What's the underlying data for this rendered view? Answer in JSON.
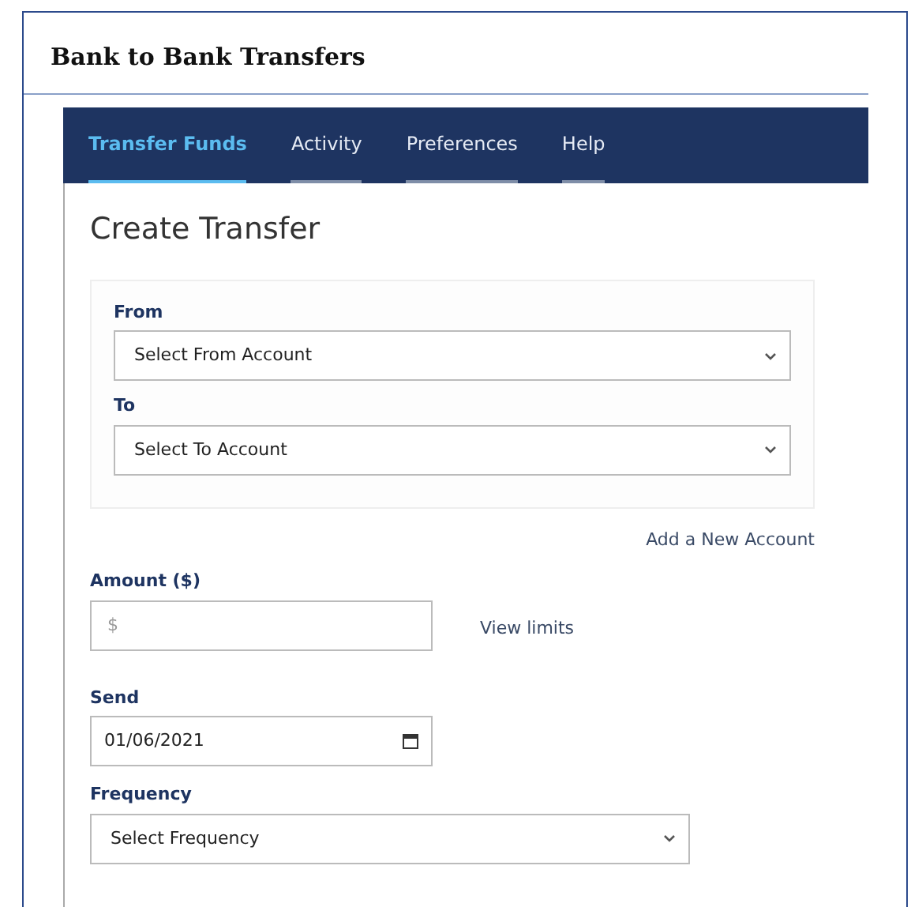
{
  "header": {
    "title": "Bank to Bank Transfers"
  },
  "tabs": [
    {
      "label": "Transfer Funds",
      "selected": true
    },
    {
      "label": "Activity",
      "selected": false
    },
    {
      "label": "Preferences",
      "selected": false
    },
    {
      "label": "Help",
      "selected": false
    }
  ],
  "form": {
    "heading": "Create Transfer",
    "account_fields": [
      {
        "label": "From",
        "value": "Select From Account"
      },
      {
        "label": "To",
        "value": "Select To Account"
      }
    ],
    "add_account_link": "Add a New Account",
    "amount": {
      "label": "Amount ($)",
      "placeholder": "$"
    },
    "view_limits_link": "View limits",
    "send": {
      "label": "Send",
      "value": "01/06/2021"
    },
    "frequency": {
      "label": "Frequency",
      "value": "Select Frequency"
    }
  }
}
